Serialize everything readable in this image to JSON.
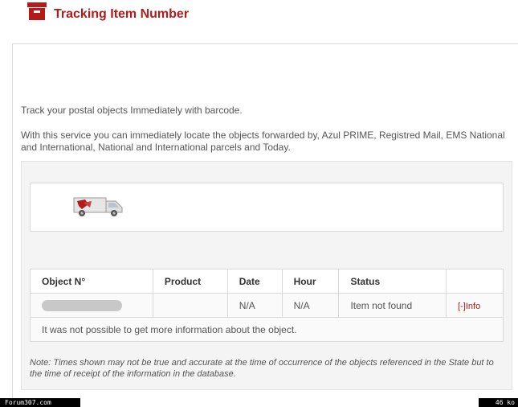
{
  "header": {
    "title": "Tracking Item Number",
    "icon": "archive-box-icon",
    "accent": "#b31b1b"
  },
  "intro": {
    "line1": "Track your postal objects Immediately with barcode.",
    "line2": "With this service you can immediately locate the objects forwarded by, Azul PRIME, Registred Mail, EMS National and International, National and International parcels and Today."
  },
  "van_icon": "delivery-van-icon",
  "table": {
    "headers": {
      "object": "Object N°",
      "product": "Product",
      "date": "Date",
      "hour": "Hour",
      "status": "Status"
    },
    "row": {
      "object": "",
      "product": "",
      "date": "N/A",
      "hour": "N/A",
      "status": "Item not found",
      "info": "[-]Info"
    },
    "message": "It was not possible to get more information about the object."
  },
  "note": "Note: Times shown may not be true and accurate at the time of occurrence of the objects referenced in the State but to the time of receipt of the information in the database.",
  "footer": {
    "left": "Forum307.com",
    "right": "46 ko"
  }
}
